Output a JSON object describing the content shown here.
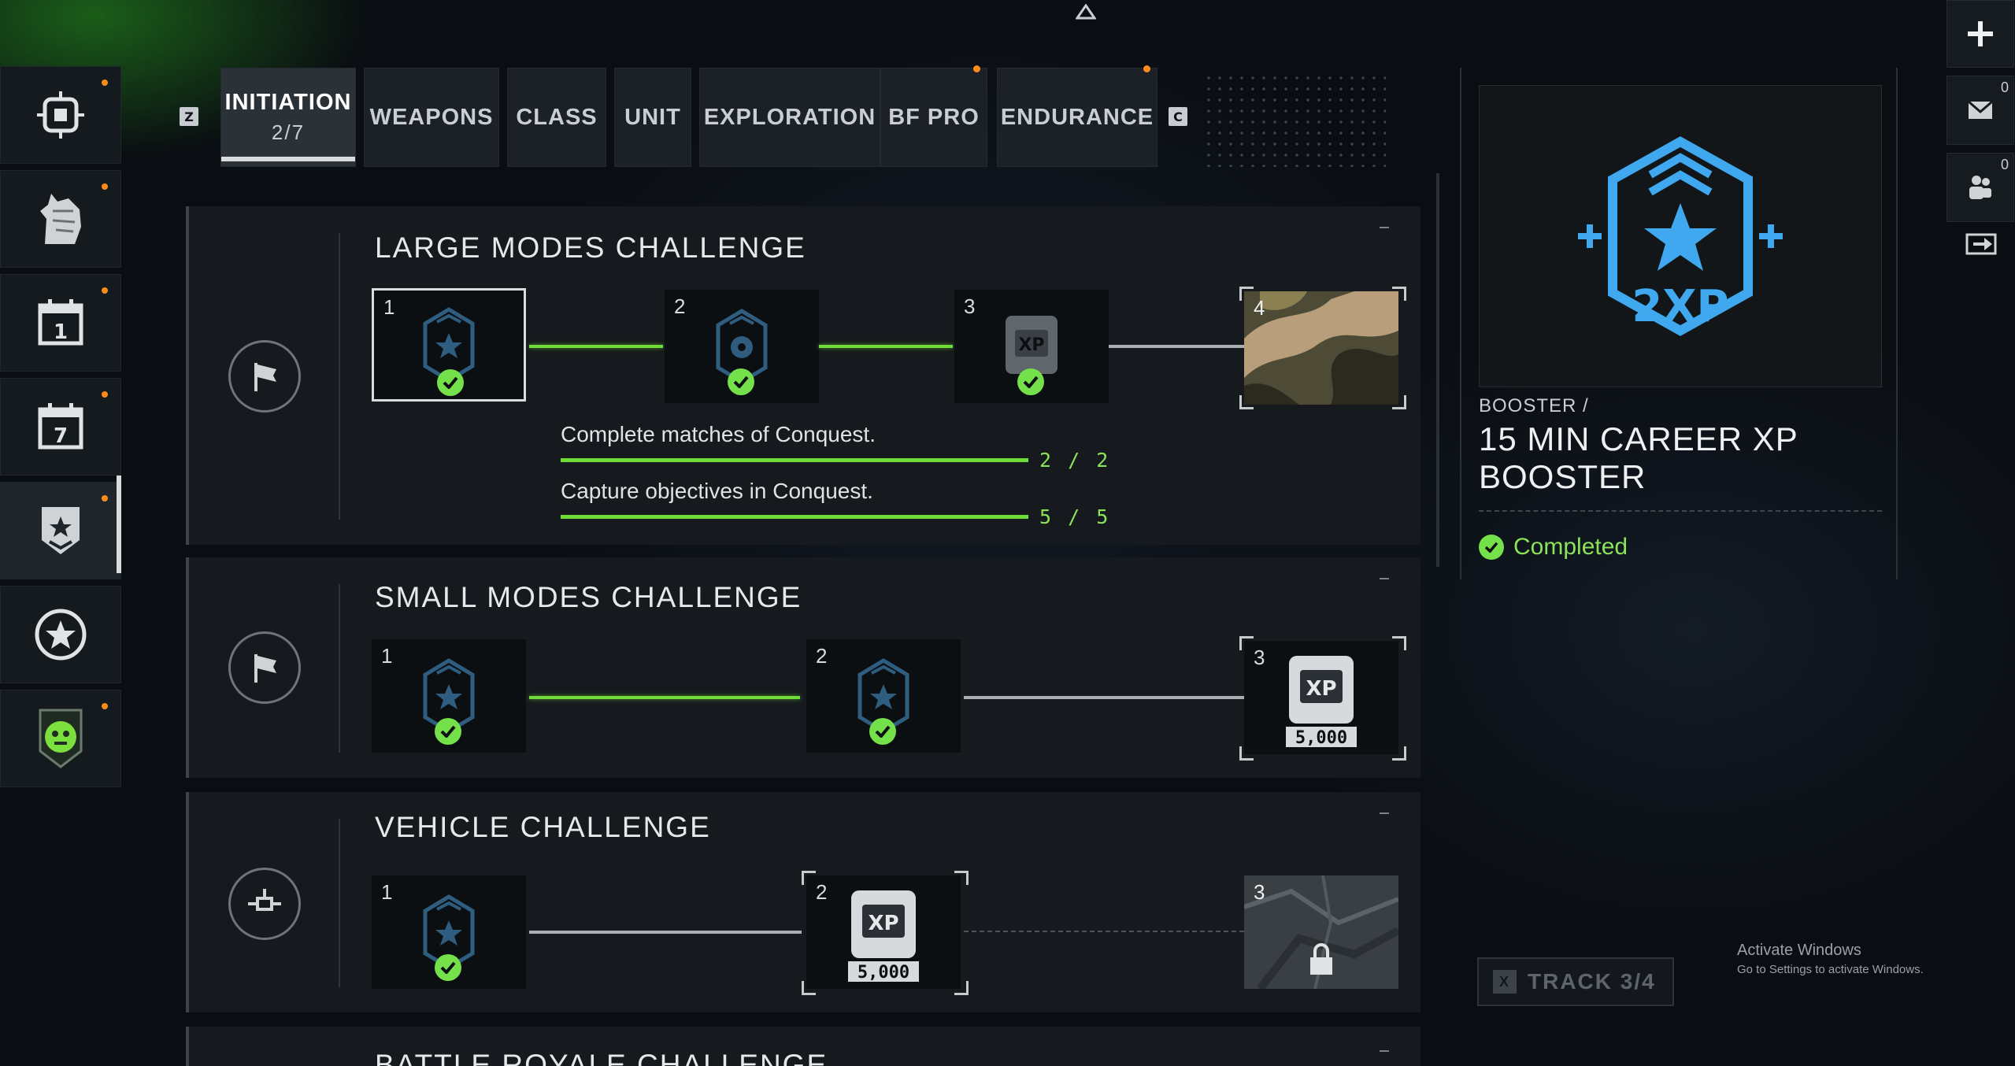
{
  "tabs": {
    "left_key": "Z",
    "right_key": "C",
    "items": [
      {
        "label": "INITIATION",
        "progress": "2/7"
      },
      {
        "label": "WEAPONS"
      },
      {
        "label": "CLASS"
      },
      {
        "label": "UNIT"
      },
      {
        "label": "EXPLORATION"
      },
      {
        "label": "BF PRO"
      },
      {
        "label": "ENDURANCE"
      }
    ]
  },
  "sidebar": {
    "items": [
      {
        "icon": "target-icon"
      },
      {
        "icon": "horse-icon"
      },
      {
        "icon": "daily-calendar-icon",
        "label": "1"
      },
      {
        "icon": "weekly-calendar-icon",
        "label": "7"
      },
      {
        "icon": "challenge-shield-icon"
      },
      {
        "icon": "star-circle-icon"
      },
      {
        "icon": "event-badge-icon"
      }
    ]
  },
  "challenges": [
    {
      "title": "LARGE MODES CHALLENGE",
      "tiles": [
        "1",
        "2",
        "3",
        "4"
      ],
      "xp_label": "XP",
      "tasks": [
        {
          "text": "Complete matches of Conquest.",
          "count": "2 / 2",
          "progress": 1.0
        },
        {
          "text": "Capture objectives in Conquest.",
          "count": "5 / 5",
          "progress": 1.0
        }
      ]
    },
    {
      "title": "SMALL MODES CHALLENGE",
      "tiles": [
        "1",
        "2",
        "3"
      ],
      "xp_label": "XP",
      "xp_amount": "5,000"
    },
    {
      "title": "VEHICLE CHALLENGE",
      "tiles": [
        "1",
        "2",
        "3"
      ],
      "xp_label": "XP",
      "xp_amount": "5,000"
    },
    {
      "title": "BATTLE ROYALE CHALLENGE"
    }
  ],
  "detail": {
    "badge_text": "2XP",
    "type": "BOOSTER /",
    "name": "15 MIN CAREER XP BOOSTER",
    "status": "Completed"
  },
  "right_bar": {
    "mail_count": "0",
    "friends_count": "0"
  },
  "track_button": {
    "key": "X",
    "label": "TRACK 3/4"
  },
  "watermark": {
    "line1": "Activate Windows",
    "line2": "Go to Settings to activate Windows."
  },
  "colors": {
    "accent_green": "#6fdc3a",
    "booster_blue": "#3fa8ef",
    "notify_orange": "#ff8a1c"
  }
}
